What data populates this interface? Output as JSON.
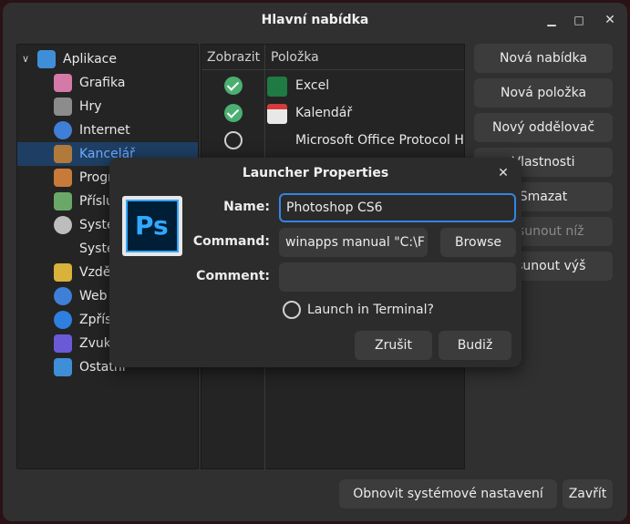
{
  "window": {
    "title": "Hlavní nabídka",
    "minimize": "▁",
    "maximize": "□",
    "close": "✕"
  },
  "tree": {
    "root": {
      "label": "Aplikace",
      "expand": "∨"
    },
    "items": [
      {
        "label": "Grafika",
        "color": "#d57aa6"
      },
      {
        "label": "Hry",
        "color": "#8c8c8c"
      },
      {
        "label": "Internet",
        "color": "#3f7fd8"
      },
      {
        "label": "Kancelář",
        "color": "#b07a3a"
      },
      {
        "label": "Programování",
        "color": "#c87a3a"
      },
      {
        "label": "Příslušenství",
        "color": "#6aa86a"
      },
      {
        "label": "Systém",
        "color": "#bdbdbd"
      },
      {
        "label": "Systém",
        "color": ""
      },
      {
        "label": "Vzdělávání",
        "color": "#d8b23a"
      },
      {
        "label": "Web",
        "color": "#3f7fd8"
      },
      {
        "label": "Zpřístupnění",
        "color": "#2f7fe0"
      },
      {
        "label": "Zvuk a video",
        "color": "#6a5ad8"
      },
      {
        "label": "Ostatní",
        "color": "#3f8fd8"
      }
    ],
    "selected_index": 3
  },
  "list": {
    "col_show": "Zobrazit",
    "col_item": "Položka",
    "rows": [
      {
        "checked": true,
        "label": "Excel",
        "icon_color": "#1f7a44"
      },
      {
        "checked": true,
        "label": "Kalendář",
        "icon_color": "#e8e8e8"
      },
      {
        "checked": false,
        "label": "Microsoft Office Protocol H",
        "icon_color": ""
      }
    ]
  },
  "buttons": {
    "new_menu": "Nová nabídka",
    "new_item": "Nová položka",
    "new_separator": "Nový oddělovač",
    "properties": "Vlastnosti",
    "delete": "Smazat",
    "move_down": "Posunout níž",
    "move_up": "Posunout výš",
    "restore": "Obnovit systémové nastavení",
    "close": "Zavřít"
  },
  "dialog": {
    "title": "Launcher Properties",
    "close": "✕",
    "icon_text": "Ps",
    "name_label": "Name:",
    "name_value": "Photoshop CS6",
    "command_label": "Command:",
    "command_value": "winapps manual \"C:\\F",
    "browse": "Browse",
    "comment_label": "Comment:",
    "comment_value": "",
    "terminal_label": "Launch in Terminal?",
    "cancel": "Zrušit",
    "ok": "Budiž"
  },
  "colors": {
    "accent": "#3584e4",
    "selection": "#1e3f63",
    "check": "#4caf72"
  }
}
